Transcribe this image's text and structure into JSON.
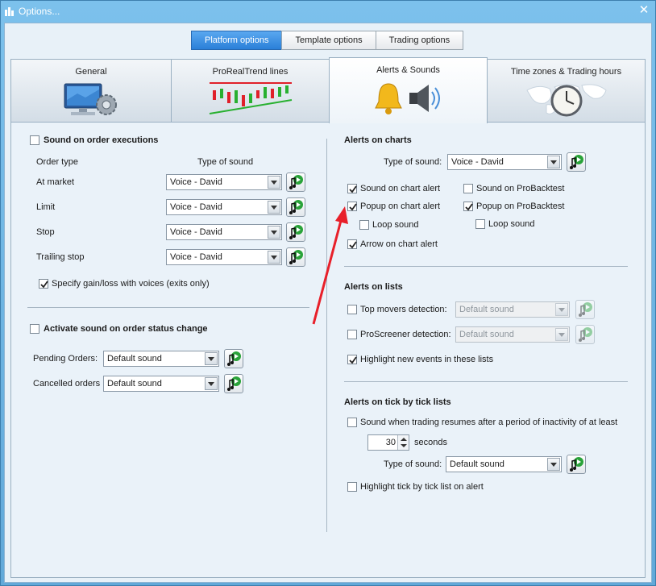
{
  "window": {
    "title": "Options..."
  },
  "top_buttons": [
    "Platform options",
    "Template options",
    "Trading options"
  ],
  "tabs": [
    "General",
    "ProRealTrend lines",
    "Alerts & Sounds",
    "Time zones & Trading hours"
  ],
  "left": {
    "order_exec": {
      "title": "Sound on order executions",
      "col_order_type": "Order type",
      "col_sound": "Type of sound",
      "rows": [
        {
          "label": "At market",
          "value": "Voice - David"
        },
        {
          "label": "Limit",
          "value": "Voice - David"
        },
        {
          "label": "Stop",
          "value": "Voice - David"
        },
        {
          "label": "Trailing stop",
          "value": "Voice - David"
        }
      ],
      "gain_loss": "Specify gain/loss with voices (exits only)"
    },
    "status": {
      "title": "Activate sound on order status change",
      "pending_label": "Pending Orders:",
      "pending_value": "Default sound",
      "cancelled_label": "Cancelled orders",
      "cancelled_value": "Default sound"
    }
  },
  "right": {
    "charts": {
      "title": "Alerts on charts",
      "type_label": "Type of sound:",
      "type_value": "Voice - David",
      "sound_chart": "Sound on chart alert",
      "sound_backtest": "Sound on ProBacktest",
      "popup_chart": "Popup on chart alert",
      "popup_backtest": "Popup on ProBacktest",
      "loop1": "Loop sound",
      "loop2": "Loop sound",
      "arrow": "Arrow on chart alert"
    },
    "lists": {
      "title": "Alerts on lists",
      "top_movers": "Top movers detection:",
      "top_movers_value": "Default sound",
      "proscreener": "ProScreener detection:",
      "proscreener_value": "Default sound",
      "highlight": "Highlight new events in these lists"
    },
    "tick": {
      "title": "Alerts on tick by tick lists",
      "resume": "Sound when trading resumes after a period of inactivity of at least",
      "seconds_value": "30",
      "seconds_label": "seconds",
      "type_label": "Type of sound:",
      "type_value": "Default sound",
      "highlight_tick": "Highlight tick by tick list on alert"
    }
  },
  "colors": {
    "accent": "#2a7fd8",
    "window_bg": "#6fb4e2",
    "arrow": "#e8202a"
  }
}
